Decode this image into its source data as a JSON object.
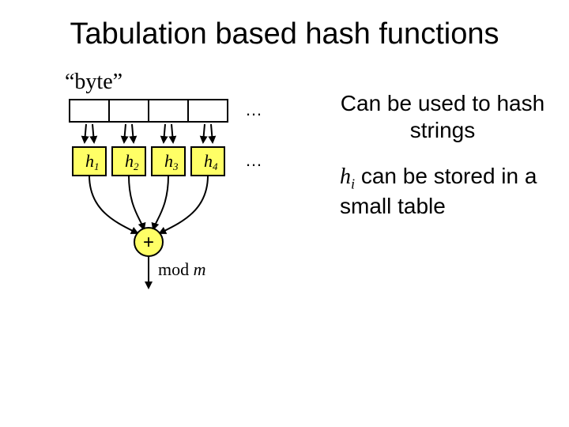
{
  "title": "Tabulation based hash functions",
  "byte_label": "“byte”",
  "ellipsis_top": "…",
  "ellipsis_bottom": "…",
  "hash_boxes": {
    "h1": "h",
    "h1_sub": "1",
    "h2": "h",
    "h2_sub": "2",
    "h3": "h",
    "h3_sub": "3",
    "h4": "h",
    "h4_sub": "4"
  },
  "plus_symbol": "+",
  "mod_text": "mod m",
  "right": {
    "line1": "Can be used to hash strings",
    "line2_lead_h": "h",
    "line2_lead_i": "i",
    "line2_rest": " can be stored in a small table"
  }
}
